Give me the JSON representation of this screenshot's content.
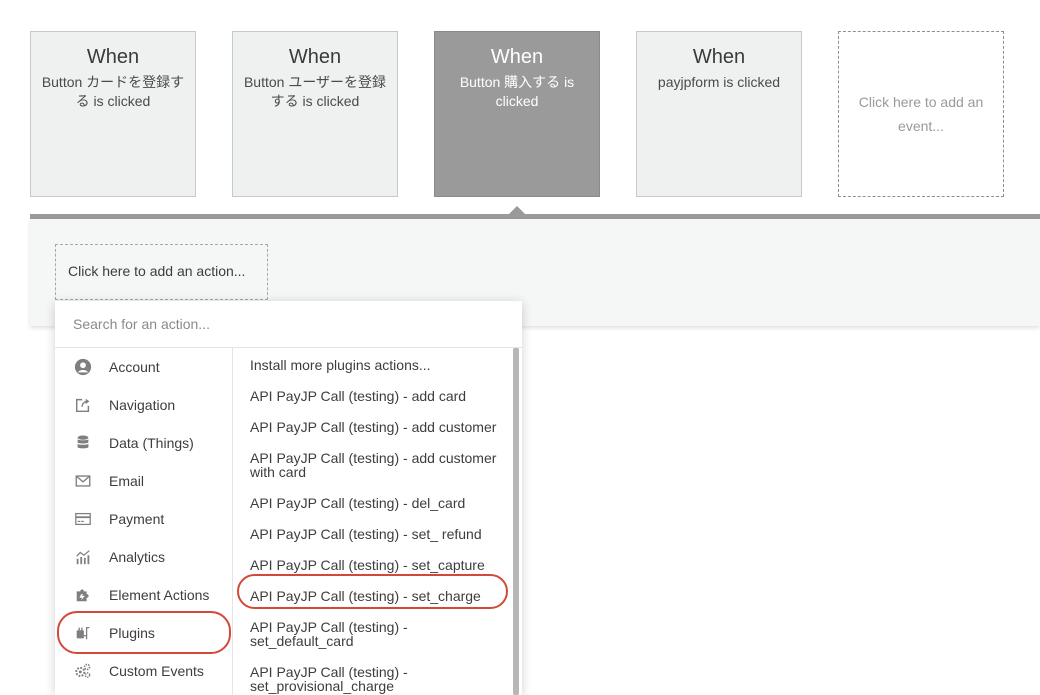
{
  "events": [
    {
      "title": "When",
      "desc": "Button カードを登録する is clicked",
      "selected": false
    },
    {
      "title": "When",
      "desc": "Button ユーザーを登録する is clicked",
      "selected": false
    },
    {
      "title": "When",
      "desc": "Button 購入する is clicked",
      "selected": true
    },
    {
      "title": "When",
      "desc": "payjpform is clicked",
      "selected": false
    }
  ],
  "add_event_label": "Click here to add an event...",
  "add_action_label": "Click here to add an action...",
  "search": {
    "placeholder": "Search for an action..."
  },
  "categories": [
    {
      "label": "Account",
      "icon": "account-icon"
    },
    {
      "label": "Navigation",
      "icon": "navigation-icon"
    },
    {
      "label": "Data (Things)",
      "icon": "database-icon"
    },
    {
      "label": "Email",
      "icon": "email-icon"
    },
    {
      "label": "Payment",
      "icon": "credit-card-icon"
    },
    {
      "label": "Analytics",
      "icon": "analytics-icon"
    },
    {
      "label": "Element Actions",
      "icon": "puzzle-icon"
    },
    {
      "label": "Plugins",
      "icon": "plug-icon"
    },
    {
      "label": "Custom Events",
      "icon": "gears-icon"
    }
  ],
  "highlighted_category": "Plugins",
  "actions": [
    {
      "lines": [
        "Install more plugins actions..."
      ]
    },
    {
      "lines": [
        "API PayJP Call (testing) - add card"
      ]
    },
    {
      "lines": [
        "API PayJP Call (testing) - add customer"
      ]
    },
    {
      "lines": [
        "API PayJP Call (testing) - add customer",
        "with card"
      ]
    },
    {
      "lines": [
        "API PayJP Call (testing) - del_card"
      ]
    },
    {
      "lines": [
        "API PayJP Call (testing) - set_ refund"
      ]
    },
    {
      "lines": [
        "API PayJP Call (testing) - set_capture"
      ]
    },
    {
      "lines": [
        "API PayJP Call (testing) - set_charge"
      ]
    },
    {
      "lines": [
        "API PayJP Call (testing) -",
        "set_default_card"
      ]
    },
    {
      "lines": [
        "API PayJP Call (testing) -",
        "set_provisional_charge"
      ]
    }
  ],
  "highlighted_action": "API PayJP Call (testing) - set_charge",
  "colors": {
    "highlight": "#d2493a",
    "selected_event": "#9a9a9a",
    "event_bg": "#eff1f1"
  }
}
